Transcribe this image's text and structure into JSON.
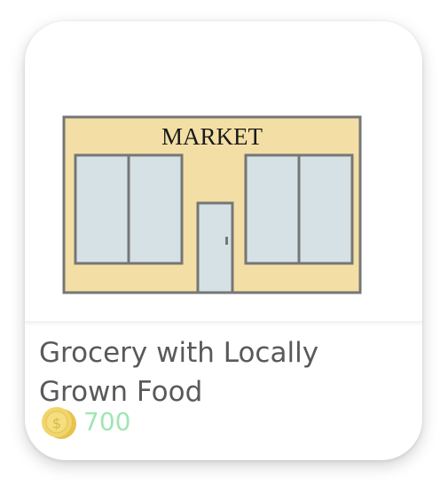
{
  "item": {
    "sign_text": "MARKET",
    "title": "Grocery with Locally Grown Food",
    "price": "700",
    "price_icon": "coin-icon"
  },
  "colors": {
    "building_fill": "#f3dfa5",
    "building_stroke": "#767676",
    "window_fill": "#d5e1e4",
    "price_text": "#9fe6b4",
    "title_text": "#595959",
    "coin_gold": "#f2d56a"
  }
}
